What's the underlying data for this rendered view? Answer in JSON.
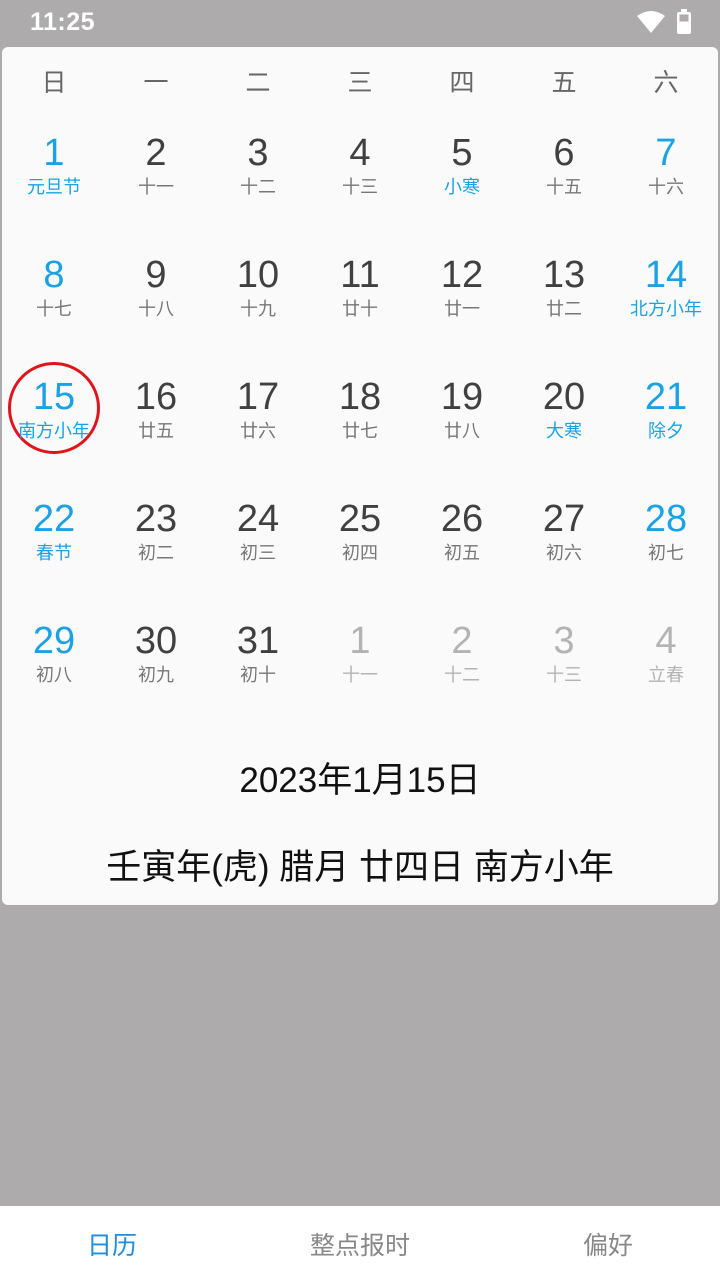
{
  "status_bar": {
    "time": "11:25",
    "wifi_icon": "wifi-icon",
    "battery_icon": "battery-icon"
  },
  "calendar": {
    "weekdays": [
      "日",
      "一",
      "二",
      "三",
      "四",
      "五",
      "六"
    ],
    "weeks": [
      [
        {
          "num": "1",
          "sub": "元旦节",
          "style": "blue blue-sub"
        },
        {
          "num": "2",
          "sub": "十一",
          "style": ""
        },
        {
          "num": "3",
          "sub": "十二",
          "style": ""
        },
        {
          "num": "4",
          "sub": "十三",
          "style": ""
        },
        {
          "num": "5",
          "sub": "小寒",
          "style": "blue-sub"
        },
        {
          "num": "6",
          "sub": "十五",
          "style": ""
        },
        {
          "num": "7",
          "sub": "十六",
          "style": "blue"
        }
      ],
      [
        {
          "num": "8",
          "sub": "十七",
          "style": "blue"
        },
        {
          "num": "9",
          "sub": "十八",
          "style": ""
        },
        {
          "num": "10",
          "sub": "十九",
          "style": ""
        },
        {
          "num": "11",
          "sub": "廿十",
          "style": ""
        },
        {
          "num": "12",
          "sub": "廿一",
          "style": ""
        },
        {
          "num": "13",
          "sub": "廿二",
          "style": ""
        },
        {
          "num": "14",
          "sub": "北方小年",
          "style": "blue blue-sub"
        }
      ],
      [
        {
          "num": "15",
          "sub": "南方小年",
          "style": "blue blue-sub"
        },
        {
          "num": "16",
          "sub": "廿五",
          "style": ""
        },
        {
          "num": "17",
          "sub": "廿六",
          "style": ""
        },
        {
          "num": "18",
          "sub": "廿七",
          "style": ""
        },
        {
          "num": "19",
          "sub": "廿八",
          "style": ""
        },
        {
          "num": "20",
          "sub": "大寒",
          "style": "blue-sub"
        },
        {
          "num": "21",
          "sub": "除夕",
          "style": "blue blue-sub"
        }
      ],
      [
        {
          "num": "22",
          "sub": "春节",
          "style": "blue blue-sub"
        },
        {
          "num": "23",
          "sub": "初二",
          "style": ""
        },
        {
          "num": "24",
          "sub": "初三",
          "style": ""
        },
        {
          "num": "25",
          "sub": "初四",
          "style": ""
        },
        {
          "num": "26",
          "sub": "初五",
          "style": ""
        },
        {
          "num": "27",
          "sub": "初六",
          "style": ""
        },
        {
          "num": "28",
          "sub": "初七",
          "style": "blue"
        }
      ],
      [
        {
          "num": "29",
          "sub": "初八",
          "style": "blue"
        },
        {
          "num": "30",
          "sub": "初九",
          "style": ""
        },
        {
          "num": "31",
          "sub": "初十",
          "style": ""
        },
        {
          "num": "1",
          "sub": "十一",
          "style": "faded"
        },
        {
          "num": "2",
          "sub": "十二",
          "style": "faded"
        },
        {
          "num": "3",
          "sub": "十三",
          "style": "faded"
        },
        {
          "num": "4",
          "sub": "立春",
          "style": "faded"
        }
      ]
    ],
    "selected_date": "2023年1月15日",
    "lunar_info": "壬寅年(虎) 腊月 廿四日 南方小年"
  },
  "bottom_nav": {
    "items": [
      {
        "label": "日历",
        "active": true
      },
      {
        "label": "整点报时",
        "active": false
      },
      {
        "label": "偏好",
        "active": false
      }
    ]
  },
  "colors": {
    "accent_blue": "#1aa2e4",
    "today_ring": "#e0141a",
    "backdrop": "#adabac"
  }
}
